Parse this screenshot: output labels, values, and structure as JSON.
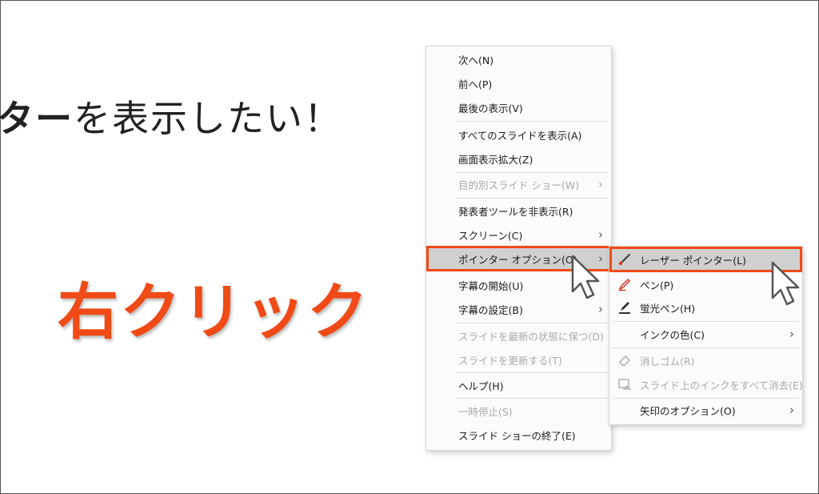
{
  "slide": {
    "title_bold": "ター",
    "title_rest": "を表示したい！",
    "caption": "右クリック"
  },
  "context_menu": {
    "items": [
      {
        "label": "次へ(N)"
      },
      {
        "label": "前へ(P)"
      },
      {
        "label": "最後の表示(V)"
      },
      {
        "label": "すべてのスライドを表示(A)"
      },
      {
        "label": "画面表示拡大(Z)"
      },
      {
        "label": "目的別スライド ショー(W)",
        "disabled": true,
        "submenu": true
      },
      {
        "label": "発表者ツールを非表示(R)"
      },
      {
        "label": "スクリーン(C)",
        "submenu": true
      },
      {
        "label": "ポインター オプション(O)",
        "submenu": true,
        "selected": true
      },
      {
        "label": "字幕の開始(U)"
      },
      {
        "label": "字幕の設定(B)",
        "submenu": true
      },
      {
        "label": "スライドを最新の状態に保つ(D)",
        "disabled": true
      },
      {
        "label": "スライドを更新する(T)",
        "disabled": true
      },
      {
        "label": "ヘルプ(H)"
      },
      {
        "label": "一時停止(S)",
        "disabled": true
      },
      {
        "label": "スライド ショーの終了(E)"
      }
    ],
    "submenu_arrow": "›"
  },
  "pointer_submenu": {
    "items": [
      {
        "label": "レーザー ポインター(L)",
        "icon": "laser-pointer-icon",
        "selected": true
      },
      {
        "label": "ペン(P)",
        "icon": "pen-icon"
      },
      {
        "label": "蛍光ペン(H)",
        "icon": "highlighter-icon"
      },
      {
        "label": "インクの色(C)",
        "submenu": true
      },
      {
        "label": "消しゴム(R)",
        "icon": "eraser-icon",
        "disabled": true
      },
      {
        "label": "スライド上のインクをすべて消去(E)",
        "icon": "erase-all-ink-icon",
        "disabled": true
      },
      {
        "label": "矢印のオプション(O)",
        "submenu": true
      }
    ]
  },
  "colors": {
    "accent": "#f04a16",
    "highlight": "#d0d0d0",
    "disabled_text": "#a9a9a9"
  }
}
